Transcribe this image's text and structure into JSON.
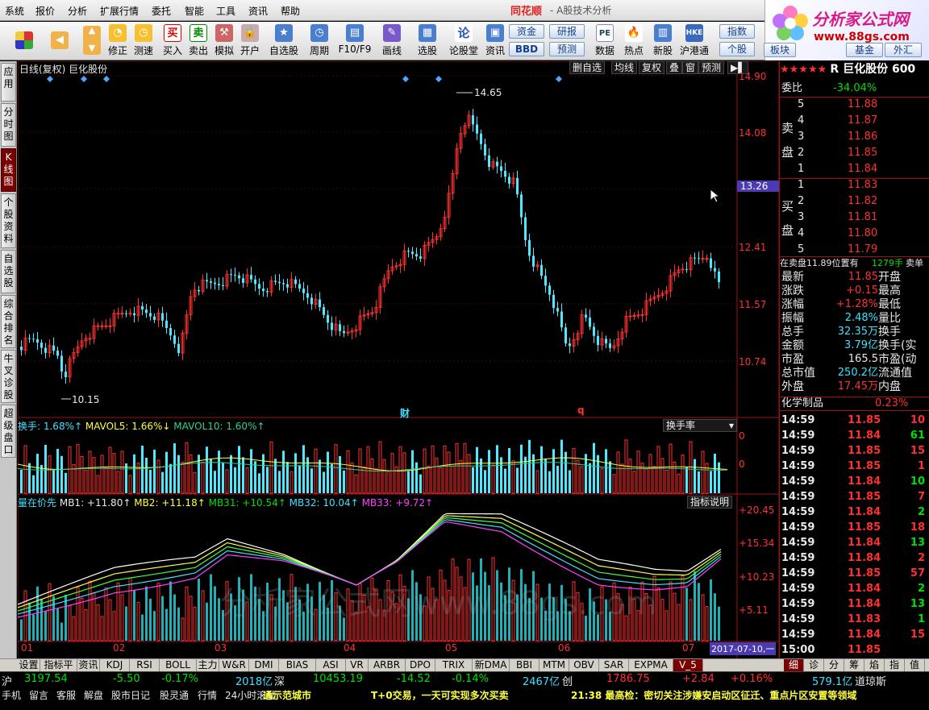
{
  "menu": {
    "items": [
      "系统",
      "报价",
      "分析",
      "扩展行情",
      "委托",
      "智能",
      "工具",
      "资讯",
      "帮助"
    ],
    "brand": "同花顺",
    "title": "- A股技术分析"
  },
  "logo": {
    "title": "分析家公式网",
    "url": "www.88gs.com"
  },
  "toolbar": {
    "buttons": [
      "修正",
      "测速",
      "买入",
      "卖出",
      "模拟",
      "开户",
      "自选股",
      "周期",
      "F10/F9",
      "画线",
      "选股",
      "论股堂",
      "资讯",
      "数据",
      "热点",
      "新股",
      "沪港通"
    ],
    "small": [
      "资金",
      "研报",
      "BBD",
      "预测",
      "指数",
      "个股",
      "板块",
      "基金",
      "外汇"
    ]
  },
  "left_tabs": [
    "应用",
    "分时图",
    "K线图",
    "个股资料",
    "自选股",
    "综合排名",
    "牛叉诊股",
    "超级盘口"
  ],
  "kline": {
    "header": "日线(复权)  巨化股份",
    "buttons": [
      "删自选",
      "均线",
      "复权",
      "叠",
      "窗",
      "预测"
    ],
    "prices": [
      "14.90",
      "14.08",
      "13.26",
      "12.41",
      "11.57",
      "10.74"
    ],
    "high_label": "14.65",
    "low_label": "10.15",
    "events": [
      "财",
      "q"
    ]
  },
  "turnover": {
    "label": "换手: 1.68%↑",
    "ma5": "MAVOL5: 1.66%↓",
    "ma10": "MAVOL10: 1.60%↑",
    "selector": "换手率",
    "scale": [
      "0",
      "0"
    ]
  },
  "indicator": {
    "name": "量在价先",
    "mb1": "MB1: +11.80↑",
    "mb2": "MB2: +11.18↑",
    "mb31": "MB31: +10.54↑",
    "mb32": "MB32: 10.04↑",
    "mb33": "MB33: +9.72↑",
    "help": "指标说明",
    "scale": [
      "+20.45",
      "+15.34",
      "+10.23",
      "+5.11"
    ]
  },
  "xaxis": {
    "months": [
      "01",
      "02",
      "03",
      "04",
      "05",
      "06",
      "07"
    ],
    "date": "2017-07-10,一"
  },
  "watermark": "分析家公式网www.88gs.com",
  "stock": {
    "stars": "★★★★★",
    "name": "R 巨化股份 600",
    "weibi_label": "委比",
    "weibi": "-34.04%",
    "sell_label": "卖盘",
    "buy_label": "买盘",
    "sell": [
      {
        "n": "5",
        "p": "11.88"
      },
      {
        "n": "4",
        "p": "11.87"
      },
      {
        "n": "3",
        "p": "11.86"
      },
      {
        "n": "2",
        "p": "11.85"
      },
      {
        "n": "1",
        "p": "11.84"
      }
    ],
    "buy": [
      {
        "n": "1",
        "p": "11.83"
      },
      {
        "n": "2",
        "p": "11.82"
      },
      {
        "n": "3",
        "p": "11.81"
      },
      {
        "n": "4",
        "p": "11.80"
      },
      {
        "n": "5",
        "p": "11.79"
      }
    ],
    "pending": "在卖盘11.89位置有",
    "pending_vol": "1279手",
    "pending_side": "卖单",
    "stats": [
      {
        "k": "最新",
        "v": "11.85",
        "k2": "开盘",
        "c": "red"
      },
      {
        "k": "涨跌",
        "v": "+0.15",
        "k2": "最高",
        "c": "red"
      },
      {
        "k": "涨幅",
        "v": "+1.28%",
        "k2": "最低",
        "c": "red"
      },
      {
        "k": "振幅",
        "v": "2.48%",
        "k2": "量比",
        "c": "cyn"
      },
      {
        "k": "总手",
        "v": "32.35万",
        "k2": "换手",
        "c": "cyn"
      },
      {
        "k": "金额",
        "v": "3.79亿",
        "k2": "换手(实",
        "c": "cyn"
      },
      {
        "k": "市盈",
        "v": "165.5",
        "k2": "市盈(动",
        "c": "wht"
      },
      {
        "k": "总市值",
        "v": "250.2亿",
        "k2": "流通值",
        "c": "cyn"
      },
      {
        "k": "外盘",
        "v": "17.45万",
        "k2": "内盘",
        "c": "red"
      }
    ],
    "sector": "化学制品",
    "sector_pct": "0.23%",
    "ticks": [
      {
        "t": "14:59",
        "p": "11.85",
        "v": "10",
        "pc": "red",
        "vc": "red"
      },
      {
        "t": "14:59",
        "p": "11.84",
        "v": "61",
        "pc": "red",
        "vc": "grn"
      },
      {
        "t": "14:59",
        "p": "11.85",
        "v": "15",
        "pc": "red",
        "vc": "red"
      },
      {
        "t": "14:59",
        "p": "11.85",
        "v": "1",
        "pc": "red",
        "vc": "red"
      },
      {
        "t": "14:59",
        "p": "11.84",
        "v": "10",
        "pc": "red",
        "vc": "grn"
      },
      {
        "t": "14:59",
        "p": "11.85",
        "v": "7",
        "pc": "red",
        "vc": "red"
      },
      {
        "t": "14:59",
        "p": "11.84",
        "v": "2",
        "pc": "red",
        "vc": "grn"
      },
      {
        "t": "14:59",
        "p": "11.85",
        "v": "18",
        "pc": "red",
        "vc": "red"
      },
      {
        "t": "14:59",
        "p": "11.84",
        "v": "13",
        "pc": "red",
        "vc": "grn"
      },
      {
        "t": "14:59",
        "p": "11.84",
        "v": "2",
        "pc": "red",
        "vc": "red"
      },
      {
        "t": "14:59",
        "p": "11.85",
        "v": "57",
        "pc": "red",
        "vc": "red"
      },
      {
        "t": "14:59",
        "p": "11.84",
        "v": "2",
        "pc": "red",
        "vc": "grn"
      },
      {
        "t": "14:59",
        "p": "11.84",
        "v": "13",
        "pc": "red",
        "vc": "grn"
      },
      {
        "t": "14:59",
        "p": "11.83",
        "v": "1",
        "pc": "red",
        "vc": "grn"
      },
      {
        "t": "14:59",
        "p": "11.84",
        "v": "15",
        "pc": "red",
        "vc": "red"
      },
      {
        "t": "15:00",
        "p": "11.85",
        "v": "",
        "pc": "red",
        "vc": "red"
      }
    ]
  },
  "bottom_tabs": [
    "设置",
    "指标平台",
    "资讯",
    "KDJ",
    "RSI",
    "BOLL",
    "主力",
    "W&R",
    "DMI",
    "BIAS",
    "ASI",
    "VR",
    "ARBR",
    "DPO",
    "TRIX",
    "新DMA",
    "BBI",
    "MTM",
    "OBV",
    "SAR",
    "EXPMA",
    "V_5"
  ],
  "right_tabs": [
    "细",
    "诊",
    "分",
    "筹",
    "焰",
    "指",
    "值"
  ],
  "status": {
    "sh": "沪",
    "sh_idx": "3197.54",
    "sh_chg": "-5.50",
    "sh_pct": "-0.17%",
    "sh_amt": "2018亿",
    "sz": "深",
    "sz_idx": "10453.19",
    "sz_chg": "-14.52",
    "sz_pct": "-0.14%",
    "sz_amt": "2467亿",
    "cy": "创",
    "cy_idx": "1786.75",
    "cy_chg": "+2.84",
    "cy_pct": "+0.16%",
    "cy_amt": "579.1亿",
    "dj": "道琼斯",
    "links": [
      "手机",
      "留言",
      "客服",
      "解盘",
      "股市日记",
      "股灵通",
      "行情",
      "24小时滚动"
    ],
    "news1": "通示范城市",
    "news2": "T+0交易，一天可实现多次买卖",
    "news3": "21:38 最高检：密切关注涉嫌安启动区征迁、重点片区安置等领域"
  }
}
